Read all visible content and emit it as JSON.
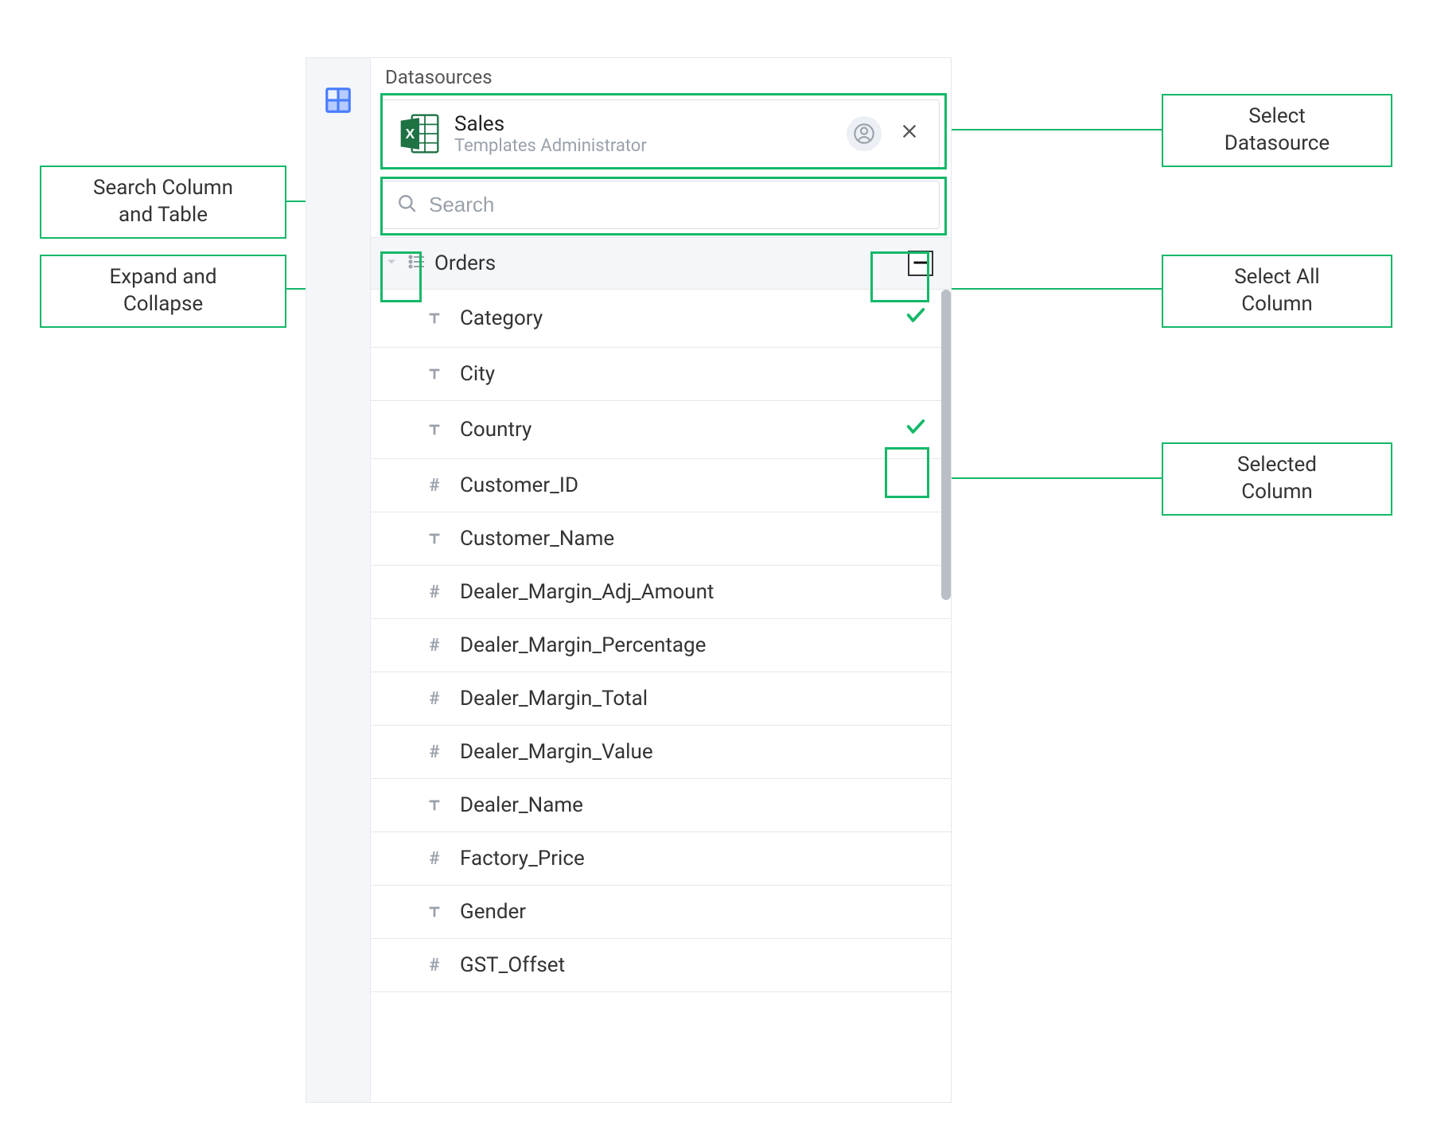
{
  "annotations": {
    "search": "Search Column\nand Table",
    "expand": "Expand and\nCollapse",
    "select_ds": "Select\nDatasource",
    "select_all": "Select All\nColumn",
    "selected_col": "Selected\nColumn"
  },
  "header": {
    "section_label": "Datasources"
  },
  "datasource": {
    "name": "Sales",
    "subtitle": "Templates Administrator"
  },
  "search": {
    "placeholder": "Search"
  },
  "table": {
    "name": "Orders",
    "tristate_glyph": "—"
  },
  "columns": [
    {
      "type": "text",
      "name": "Category",
      "selected": true
    },
    {
      "type": "text",
      "name": "City",
      "selected": false
    },
    {
      "type": "text",
      "name": "Country",
      "selected": true
    },
    {
      "type": "number",
      "name": "Customer_ID",
      "selected": false
    },
    {
      "type": "text",
      "name": "Customer_Name",
      "selected": false
    },
    {
      "type": "number",
      "name": "Dealer_Margin_Adj_Amount",
      "selected": false
    },
    {
      "type": "number",
      "name": "Dealer_Margin_Percentage",
      "selected": false
    },
    {
      "type": "number",
      "name": "Dealer_Margin_Total",
      "selected": false
    },
    {
      "type": "number",
      "name": "Dealer_Margin_Value",
      "selected": false
    },
    {
      "type": "text",
      "name": "Dealer_Name",
      "selected": false
    },
    {
      "type": "number",
      "name": "Factory_Price",
      "selected": false
    },
    {
      "type": "text",
      "name": "Gender",
      "selected": false
    },
    {
      "type": "number",
      "name": "GST_Offset",
      "selected": false
    }
  ]
}
